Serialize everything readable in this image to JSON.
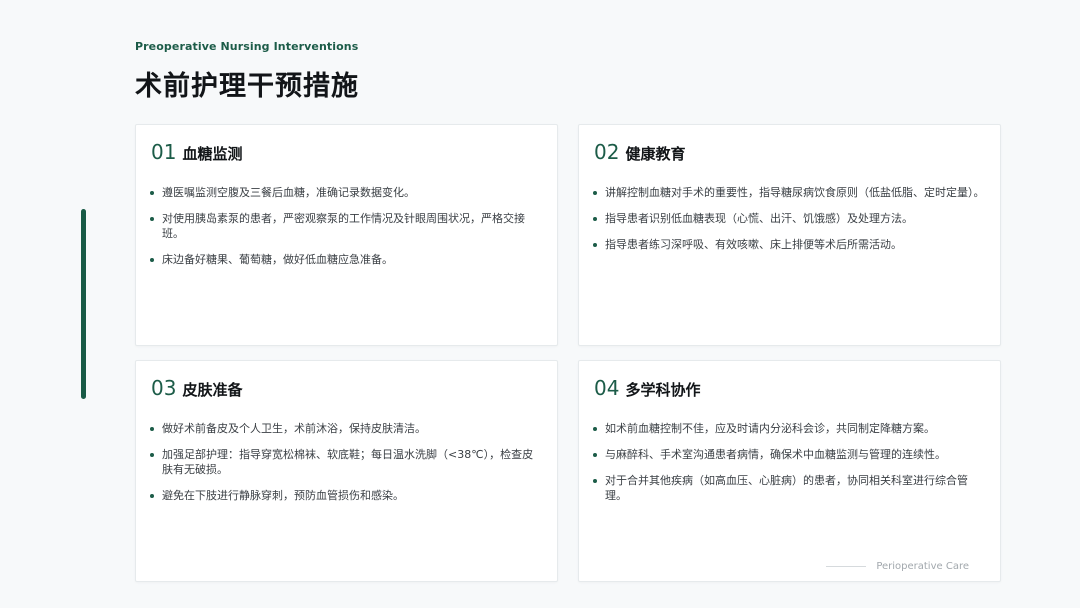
{
  "header": {
    "subtitle": "Preoperative Nursing Interventions",
    "title": "术前护理干预措施"
  },
  "cards": [
    {
      "number": "01",
      "title": "血糖监测",
      "items": [
        "遵医嘱监测空腹及三餐后血糖，准确记录数据变化。",
        "对使用胰岛素泵的患者，严密观察泵的工作情况及针眼周围状况，严格交接班。",
        "床边备好糖果、葡萄糖，做好低血糖应急准备。"
      ]
    },
    {
      "number": "02",
      "title": "健康教育",
      "items": [
        "讲解控制血糖对手术的重要性，指导糖尿病饮食原则（低盐低脂、定时定量）。",
        "指导患者识别低血糖表现（心慌、出汗、饥饿感）及处理方法。",
        "指导患者练习深呼吸、有效咳嗽、床上排便等术后所需活动。"
      ]
    },
    {
      "number": "03",
      "title": "皮肤准备",
      "items": [
        "做好术前备皮及个人卫生，术前沐浴，保持皮肤清洁。",
        "加强足部护理：指导穿宽松棉袜、软底鞋；每日温水洗脚（<38℃），检查皮肤有无破损。",
        "避免在下肢进行静脉穿刺，预防血管损伤和感染。"
      ]
    },
    {
      "number": "04",
      "title": "多学科协作",
      "items": [
        "如术前血糖控制不佳，应及时请内分泌科会诊，共同制定降糖方案。",
        "与麻醉科、手术室沟通患者病情，确保术中血糖监测与管理的连续性。",
        "对于合并其他疾病（如高血压、心脏病）的患者，协同相关科室进行综合管理。"
      ]
    }
  ],
  "footer": {
    "text": "Perioperative Care"
  },
  "colors": {
    "accent": "#1c5c48",
    "background": "#f7f9fa",
    "card": "#ffffff"
  }
}
